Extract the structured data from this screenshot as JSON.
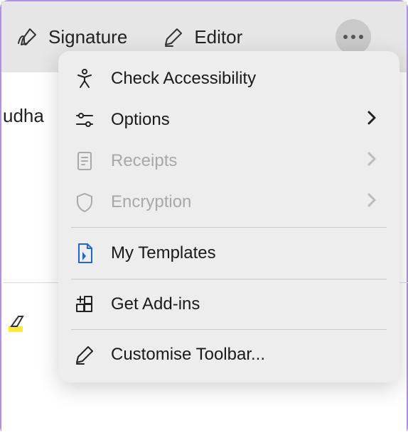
{
  "toolbar": {
    "signature_label": "Signature",
    "editor_label": "Editor"
  },
  "partial_bg_text": "udha",
  "menu": {
    "check_accessibility": "Check Accessibility",
    "options": "Options",
    "receipts": "Receipts",
    "encryption": "Encryption",
    "my_templates": "My Templates",
    "get_addins": "Get Add-ins",
    "customise_toolbar": "Customise Toolbar..."
  }
}
